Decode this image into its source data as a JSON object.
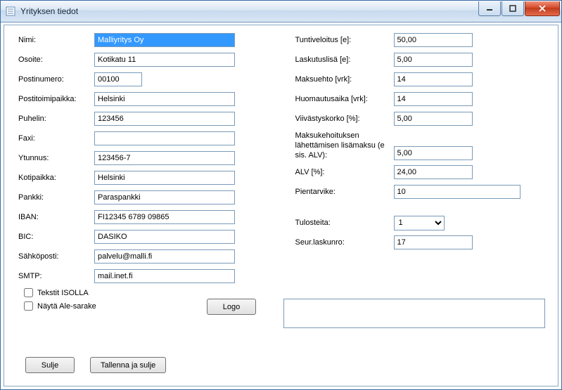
{
  "window": {
    "title": "Yrityksen tiedot"
  },
  "left": {
    "nimi_label": "Nimi:",
    "nimi_value": "Malliyritys Oy",
    "osoite_label": "Osoite:",
    "osoite_value": "Kotikatu 11",
    "postinumero_label": "Postinumero:",
    "postinumero_value": "00100",
    "postitoimipaikka_label": "Postitoimipaikka:",
    "postitoimipaikka_value": "Helsinki",
    "puhelin_label": "Puhelin:",
    "puhelin_value": "123456",
    "faxi_label": "Faxi:",
    "faxi_value": "",
    "ytunnus_label": "Ytunnus:",
    "ytunnus_value": "123456-7",
    "kotipaikka_label": "Kotipaikka:",
    "kotipaikka_value": "Helsinki",
    "pankki_label": "Pankki:",
    "pankki_value": "Paraspankki",
    "iban_label": "IBAN:",
    "iban_value": "FI12345 6789 09865",
    "bic_label": "BIC:",
    "bic_value": "DASIKO",
    "sahkoposti_label": "Sähköposti:",
    "sahkoposti_value": "palvelu@malli.fi",
    "smtp_label": "SMTP:",
    "smtp_value": "mail.inet.fi",
    "tekstit_isolla_label": "Tekstit ISOLLA",
    "nayta_ale_label": "Näytä Ale-sarake"
  },
  "right": {
    "tuntiveloitus_label": "Tuntiveloitus [e]:",
    "tuntiveloitus_value": "50,00",
    "laskutuslisa_label": "Laskutuslisä [e]:",
    "laskutuslisa_value": "5,00",
    "maksuehto_label": "Maksuehto [vrk]:",
    "maksuehto_value": "14",
    "huomautusaika_label": "Huomautusaika [vrk]:",
    "huomautusaika_value": "14",
    "viivastyskorko_label": "Viivästyskorko [%]:",
    "viivastyskorko_value": "5,00",
    "maksukehoitus_label": "Maksukehoituksen lähettämisen lisämaksu (e sis. ALV):",
    "maksukehoitus_value": "5,00",
    "alv_label": "ALV [%]:",
    "alv_value": "24,00",
    "pientarvike_label": "Pientarvike:",
    "pientarvike_value": "10",
    "tulosteita_label": "Tulosteita:",
    "tulosteita_value": "1",
    "seur_laskunro_label": "Seur.laskunro:",
    "seur_laskunro_value": "17"
  },
  "buttons": {
    "logo": "Logo",
    "sulje": "Sulje",
    "tallenna_ja_sulje": "Tallenna ja sulje"
  },
  "notes_value": ""
}
